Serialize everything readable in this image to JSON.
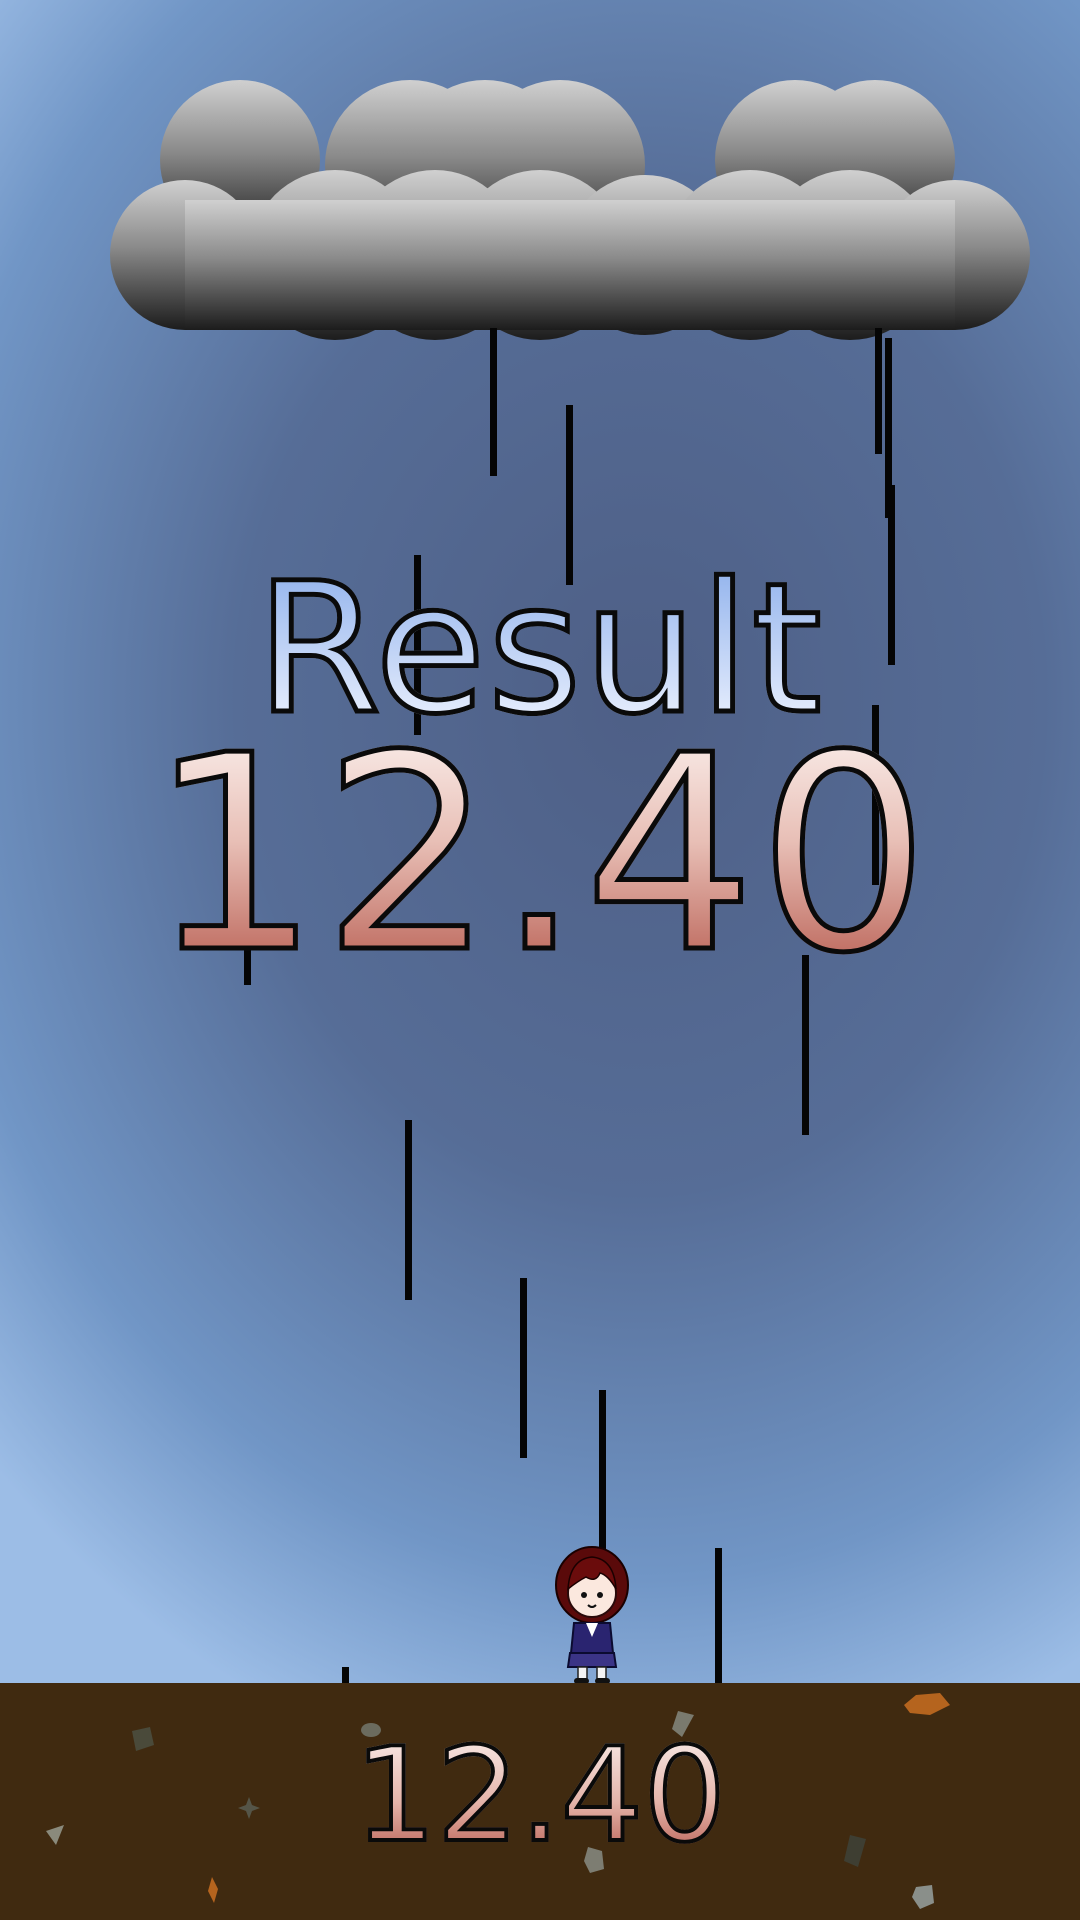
{
  "result": {
    "title": "Result",
    "score": "12.40"
  },
  "ground": {
    "score": "12.40"
  },
  "colors": {
    "sky_top": "#4f628b",
    "sky_bottom": "#9dbde6",
    "ground": "#402a10",
    "rain": "#050505",
    "cloud_top": "#c8c8c8",
    "cloud_bottom": "#1e1e1e"
  },
  "icons": {
    "cloud": "storm-cloud-icon",
    "player": "schoolgirl-character-icon"
  }
}
